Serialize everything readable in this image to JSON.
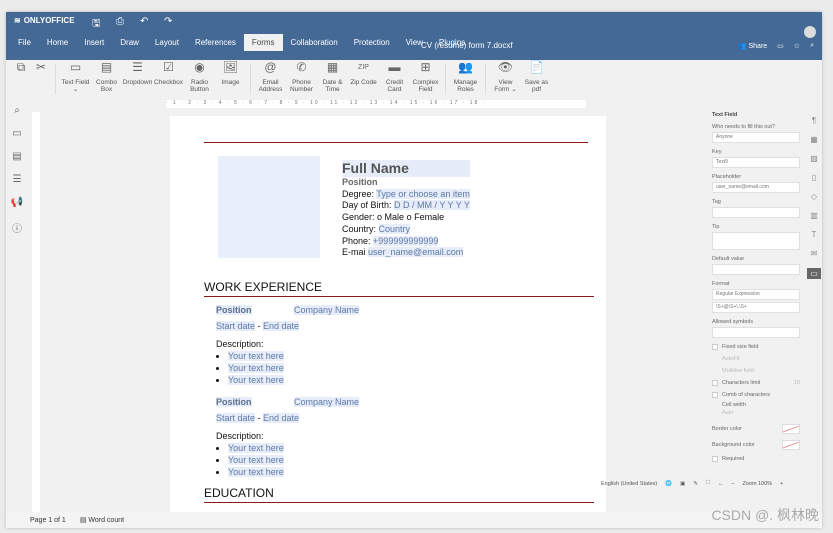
{
  "app": {
    "logo": "ONLYOFFICE",
    "title": "CV (resume) form 7.docxf"
  },
  "quick": {
    "save": "🖫",
    "print": "⎙",
    "undo": "↶",
    "redo": "↷"
  },
  "tabs": [
    "File",
    "Home",
    "Insert",
    "Draw",
    "Layout",
    "References",
    "Forms",
    "Collaboration",
    "Protection",
    "View",
    "Plugins"
  ],
  "active_tab": "Forms",
  "header_right": {
    "share": "Share"
  },
  "toolbar": [
    {
      "label": "Text Field ⌄",
      "icon": "▭"
    },
    {
      "label": "Combo Box",
      "icon": "▤"
    },
    {
      "label": "Dropdown",
      "icon": "☰"
    },
    {
      "label": "Checkbox",
      "icon": "☑"
    },
    {
      "label": "Radio Button",
      "icon": "◉"
    },
    {
      "label": "Image",
      "icon": "🖼"
    },
    {
      "label": "Email Address",
      "icon": "@"
    },
    {
      "label": "Phone Number",
      "icon": "✆"
    },
    {
      "label": "Date & Time",
      "icon": "▦"
    },
    {
      "label": "Zip Code",
      "icon": "ZIP"
    },
    {
      "label": "Credit Card",
      "icon": "▬"
    },
    {
      "label": "Complex Field",
      "icon": "⊞"
    },
    {
      "label": "Manage Roles",
      "icon": "👥"
    },
    {
      "label": "View Form ⌄",
      "icon": "👁"
    },
    {
      "label": "Save as pdf",
      "icon": "📄"
    }
  ],
  "ruler": "· 1 · 2 · 3 · 4 · 5 · 6 · 7 · 8 · 9 · 10 · 11 · 12 · 13 · 14 · 15 · 16 · 17 · 18 ·",
  "doc": {
    "full_name": "Full Name",
    "position": "Position",
    "degree_label": "Degree:",
    "degree": "Type or choose an item",
    "dob_label": "Day of Birth:",
    "dob": "D D / MM / Y Y Y Y",
    "gender_label": "Gender:",
    "male": "o Male",
    "female": "o Female",
    "country_label": "Country:",
    "country": "Country",
    "phone_label": "Phone:",
    "phone": "+999999999999",
    "email_label": "E-mai",
    "email": "user_name@email.com",
    "work": "WORK EXPERIENCE",
    "jobs": [
      {
        "position": "Position",
        "company": "Company Name",
        "start": "Start date",
        "dash": " - ",
        "end": "End date",
        "desc": "Description:",
        "items": [
          "Your text here",
          "Your text here",
          "Your text here"
        ]
      },
      {
        "position": "Position",
        "company": "Company Name",
        "start": "Start date",
        "dash": " - ",
        "end": "End date",
        "desc": "Description:",
        "items": [
          "Your text here",
          "Your text here",
          "Your text here"
        ]
      }
    ],
    "education": "EDUCATION"
  },
  "panel": {
    "title": "Text Field",
    "who_label": "Who needs to fill this out?",
    "who": "Anyone",
    "key_label": "Key",
    "key": "Text9",
    "placeholder_label": "Placeholder",
    "placeholder": "user_name@email.com",
    "tag_label": "Tag",
    "tip_label": "Tip",
    "default_label": "Default value",
    "format_label": "Format",
    "format": "Regular Expression",
    "regex": "\\S+@\\S+\\.\\S+",
    "allowed_label": "Allowed symbols",
    "fixed": "Fixed size field",
    "autofit": "AutoFit",
    "multiline": "Multiline field",
    "char_limit": "Characters limit",
    "char_limit_val": "10",
    "comb": "Comb of characters",
    "cell_width": "Cell width",
    "cell_width_val": "Auto",
    "border_color": "Border color",
    "bg_color": "Background color",
    "required": "Required"
  },
  "status": {
    "page": "Page 1 of 1",
    "word_count": "Word count",
    "language": "English (United States)",
    "zoom": "Zoom 100%"
  },
  "watermark": "CSDN @. 枫林晚",
  "colors": {
    "header": "#446995",
    "rule": "#8b1a1a",
    "field_bg": "#e6ecf8"
  }
}
